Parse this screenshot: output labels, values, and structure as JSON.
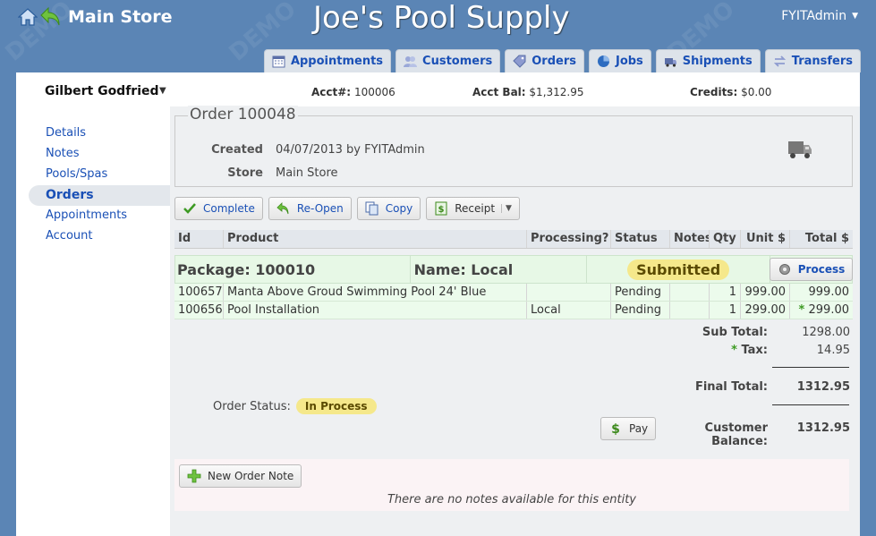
{
  "header": {
    "store_name": "Main Store",
    "app_title": "Joe's Pool Supply",
    "user": "FYITAdmin"
  },
  "tabs": [
    {
      "label": "Appointments",
      "icon": "calendar-icon"
    },
    {
      "label": "Customers",
      "icon": "people-icon"
    },
    {
      "label": "Orders",
      "icon": "tag-icon"
    },
    {
      "label": "Jobs",
      "icon": "pie-icon"
    },
    {
      "label": "Shipments",
      "icon": "truck-icon"
    },
    {
      "label": "Transfers",
      "icon": "transfer-icon"
    }
  ],
  "customer": {
    "name": "Gilbert Godfried",
    "acct_label": "Acct#:",
    "acct_value": "100006",
    "bal_label": "Acct Bal:",
    "bal_value": "$1,312.95",
    "credits_label": "Credits:",
    "credits_value": "$0.00"
  },
  "sidebar": {
    "items": [
      {
        "label": "Details"
      },
      {
        "label": "Notes"
      },
      {
        "label": "Pools/Spas"
      },
      {
        "label": "Orders"
      },
      {
        "label": "Appointments"
      },
      {
        "label": "Account"
      }
    ],
    "active": "Orders"
  },
  "order": {
    "title": "Order 100048",
    "created_label": "Created",
    "created_value": "04/07/2013 by FYITAdmin",
    "store_label": "Store",
    "store_value": "Main Store"
  },
  "toolbar": {
    "complete": "Complete",
    "reopen": "Re-Open",
    "copy": "Copy",
    "receipt": "Receipt"
  },
  "table": {
    "headers": [
      "Id",
      "Product",
      "Processing?",
      "Status",
      "Notes",
      "Qty",
      "Unit $",
      "Total $"
    ],
    "package": {
      "label": "Package: 100010",
      "name": "Name: Local",
      "status": "Submitted",
      "process": "Process"
    },
    "rows": [
      {
        "id": "100657",
        "product": "Manta Above Groud Swimming Pool 24' Blue",
        "processing": "",
        "status": "Pending",
        "notes": "",
        "qty": "1",
        "unit": "999.00",
        "total": "999.00",
        "taxed": ""
      },
      {
        "id": "100656",
        "product": "Pool Installation",
        "processing": "Local",
        "status": "Pending",
        "notes": "",
        "qty": "1",
        "unit": "299.00",
        "total": "299.00",
        "taxed": "*"
      }
    ]
  },
  "totals": {
    "subtotal_label": "Sub Total:",
    "subtotal_value": "1298.00",
    "tax_star": "*",
    "tax_label": "Tax:",
    "tax_value": "14.95",
    "final_label": "Final Total:",
    "final_value": "1312.95",
    "order_status_label": "Order Status:",
    "order_status_value": "In Process",
    "pay": "Pay",
    "balance_label": "Customer Balance:",
    "balance_value": "1312.95"
  },
  "notes": {
    "new_note": "New Order Note",
    "empty": "There are no notes available for this entity"
  },
  "watermark": "DEMO"
}
